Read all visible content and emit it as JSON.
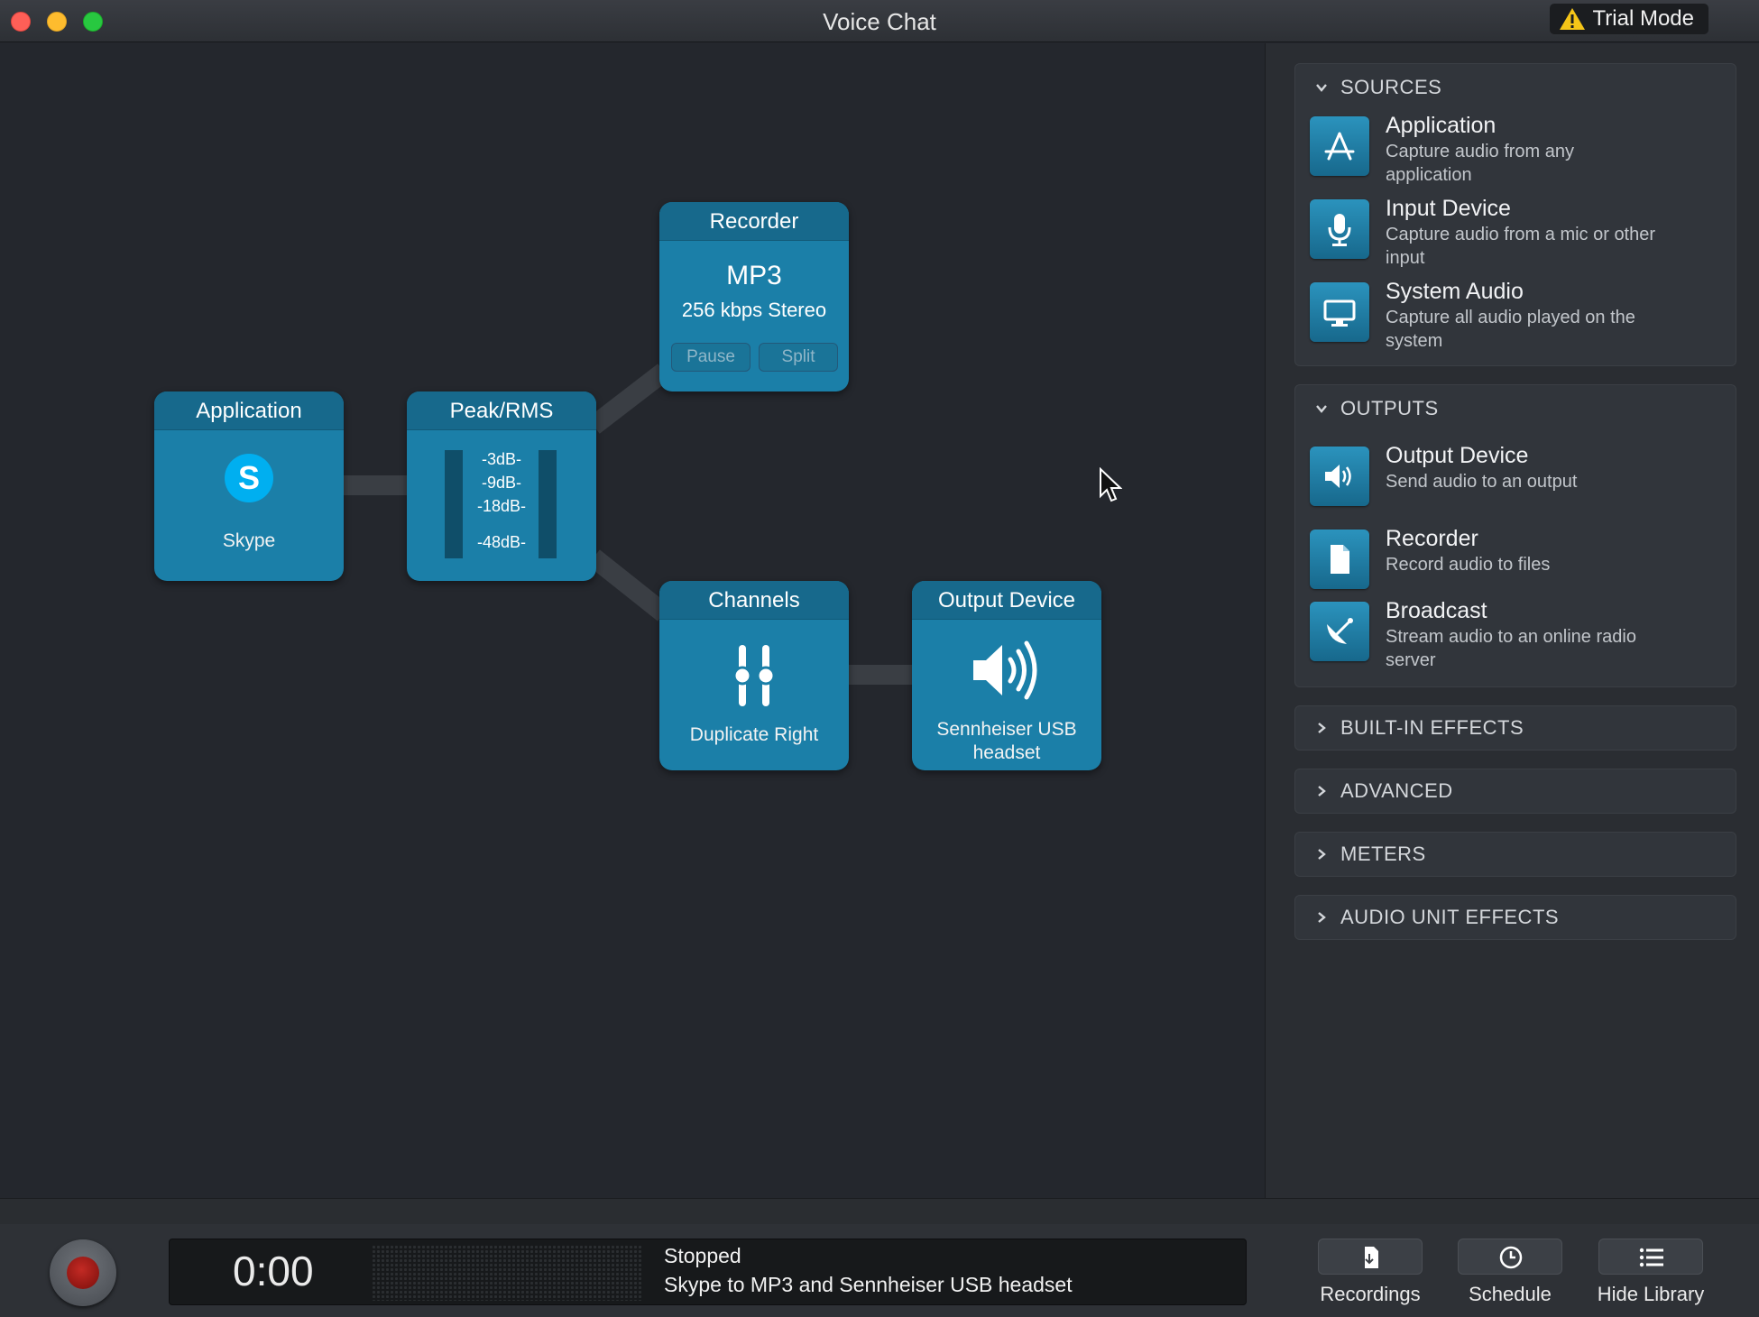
{
  "window": {
    "title": "Voice Chat",
    "trial_badge": "Trial Mode"
  },
  "nodes": {
    "application": {
      "title": "Application",
      "app_name": "Skype",
      "icon": "skype-icon"
    },
    "peak_rms": {
      "title": "Peak/RMS",
      "ticks": [
        "-3dB-",
        "-9dB-",
        "-18dB-",
        "-48dB-"
      ]
    },
    "recorder": {
      "title": "Recorder",
      "format": "MP3",
      "quality": "256 kbps Stereo",
      "pause_label": "Pause",
      "split_label": "Split"
    },
    "channels": {
      "title": "Channels",
      "mode": "Duplicate Right",
      "icon": "fader-icon"
    },
    "output_device": {
      "title": "Output Device",
      "device": "Sennheiser USB headset",
      "icon": "speaker-icon"
    }
  },
  "library": {
    "sources": {
      "heading": "SOURCES",
      "items": [
        {
          "title": "Application",
          "desc": "Capture audio from any application",
          "icon": "app-store-icon"
        },
        {
          "title": "Input Device",
          "desc": "Capture audio from a mic or other input",
          "icon": "microphone-icon"
        },
        {
          "title": "System Audio",
          "desc": "Capture all audio played on the system",
          "icon": "monitor-icon"
        }
      ]
    },
    "outputs": {
      "heading": "OUTPUTS",
      "items": [
        {
          "title": "Output Device",
          "desc": "Send audio to an output",
          "icon": "speaker-icon"
        },
        {
          "title": "Recorder",
          "desc": "Record audio to files",
          "icon": "file-icon"
        },
        {
          "title": "Broadcast",
          "desc": "Stream audio to an online radio server",
          "icon": "satellite-dish-icon"
        }
      ]
    },
    "collapsed": [
      "BUILT-IN EFFECTS",
      "ADVANCED",
      "METERS",
      "AUDIO UNIT EFFECTS"
    ]
  },
  "status_bar": {
    "time": "0:00",
    "status": "Stopped",
    "description": "Skype to MP3 and Sennheiser USB headset",
    "buttons": {
      "recordings": "Recordings",
      "schedule": "Schedule",
      "hide_library": "Hide Library"
    }
  },
  "colors": {
    "node_blue": "#1b7fa8",
    "node_header": "#17698c",
    "background": "#24272d",
    "record_red": "#c32a24"
  }
}
